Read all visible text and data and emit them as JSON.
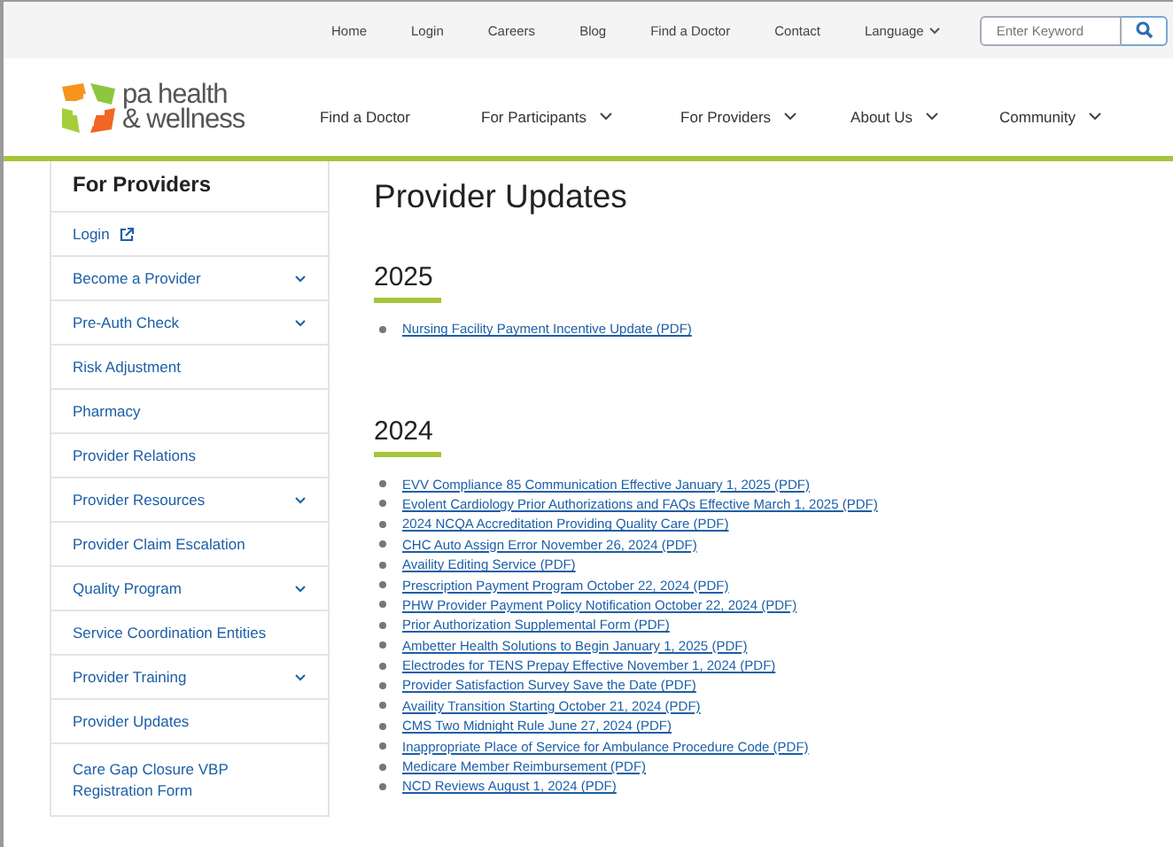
{
  "utility_nav": {
    "links": [
      "Home",
      "Login",
      "Careers",
      "Blog",
      "Find a Doctor",
      "Contact"
    ],
    "language": "Language",
    "search": {
      "placeholder": "Enter Keyword"
    }
  },
  "logo": {
    "line1": "pa health",
    "line2": "& wellness"
  },
  "main_nav": [
    {
      "label": "Find a Doctor",
      "dropdown": false
    },
    {
      "label": "For Participants",
      "dropdown": true
    },
    {
      "label": "For Providers",
      "dropdown": true
    },
    {
      "label": "About Us",
      "dropdown": true
    },
    {
      "label": "Community",
      "dropdown": true
    }
  ],
  "sidebar": {
    "title": "For Providers",
    "items": [
      {
        "label": "Login",
        "external": true,
        "expandable": false
      },
      {
        "label": "Become a Provider",
        "external": false,
        "expandable": true
      },
      {
        "label": "Pre-Auth Check",
        "external": false,
        "expandable": true
      },
      {
        "label": "Risk Adjustment",
        "external": false,
        "expandable": false
      },
      {
        "label": "Pharmacy",
        "external": false,
        "expandable": false
      },
      {
        "label": "Provider Relations",
        "external": false,
        "expandable": false
      },
      {
        "label": "Provider Resources",
        "external": false,
        "expandable": true
      },
      {
        "label": "Provider Claim Escalation",
        "external": false,
        "expandable": false
      },
      {
        "label": "Quality Program",
        "external": false,
        "expandable": true
      },
      {
        "label": "Service Coordination Entities",
        "external": false,
        "expandable": false
      },
      {
        "label": "Provider Training",
        "external": false,
        "expandable": true
      },
      {
        "label": "Provider Updates",
        "external": false,
        "expandable": false
      },
      {
        "label": "Care Gap Closure VBP Registration Form",
        "external": false,
        "expandable": false
      }
    ]
  },
  "content": {
    "title": "Provider Updates",
    "sections": [
      {
        "year": "2025",
        "links": [
          "Nursing Facility Payment Incentive Update (PDF)"
        ]
      },
      {
        "year": "2024",
        "links": [
          "EVV Compliance 85 Communication Effective January 1, 2025 (PDF)",
          "Evolent Cardiology Prior Authorizations and FAQs Effective March 1, 2025 (PDF)",
          "2024 NCQA Accreditation Providing Quality Care (PDF)",
          "CHC Auto Assign Error November 26, 2024 (PDF)",
          "Availity Editing Service (PDF)",
          "Prescription Payment Program October 22, 2024 (PDF)",
          "PHW Provider Payment Policy Notification October 22, 2024 (PDF)",
          "Prior Authorization Supplemental Form (PDF)",
          "Ambetter Health Solutions to Begin January 1, 2025 (PDF)",
          "Electrodes for TENS Prepay Effective November 1, 2024 (PDF)",
          "Provider Satisfaction Survey Save the Date (PDF)",
          "Availity Transition Starting October 21, 2024 (PDF)",
          "CMS Two Midnight Rule June 27, 2024 (PDF)",
          "Inappropriate Place of Service for Ambulance Procedure Code (PDF)",
          "Medicare Member Reimbursement (PDF)",
          "NCD Reviews August 1, 2024 (PDF)"
        ]
      }
    ]
  }
}
